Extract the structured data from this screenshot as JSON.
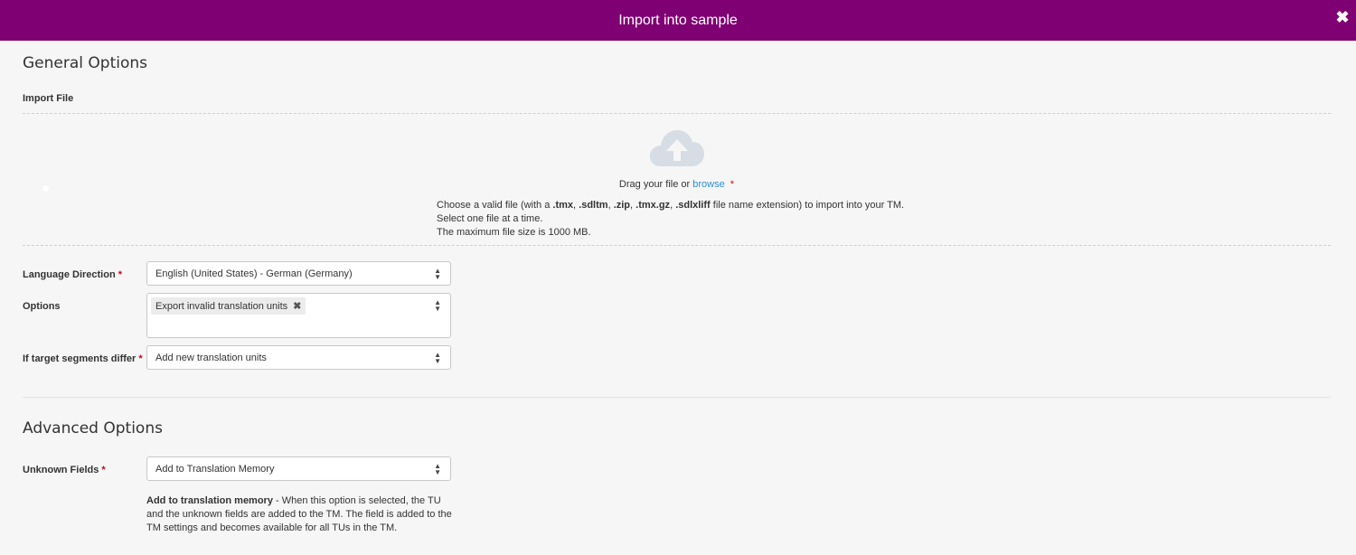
{
  "dialog": {
    "title": "Import into sample",
    "close_icon": "close-icon"
  },
  "general": {
    "title": "General Options",
    "import_file_label": "Import File",
    "upload_icon": "cloud-upload-icon",
    "drag_text": "Drag your file or",
    "browse_text": "browse",
    "required_mark": "*",
    "help": {
      "prefix": "Choose a valid file (with a",
      "ext1": ".tmx",
      "ext2": ".sdltm",
      "ext3": ".zip",
      "ext4": ".tmx.gz",
      "ext5": ".sdlxliff",
      "suffix": "file name extension) to import into your TM.",
      "line2": "Select one file at a time.",
      "line3": "The maximum file size is 1000 MB."
    },
    "language_direction": {
      "label": "Language Direction",
      "value": "English (United States) - German (Germany)"
    },
    "options": {
      "label": "Options",
      "chip": "Export invalid translation units"
    },
    "target_differ": {
      "label": "If target segments differ",
      "value": "Add new translation units"
    }
  },
  "advanced": {
    "title": "Advanced Options",
    "unknown_fields": {
      "label": "Unknown Fields",
      "value": "Add to Translation Memory"
    },
    "description": {
      "bold": "Add to translation memory",
      "text": " - When this option is selected, the TU and the unknown fields are added to the TM. The field is added to the TM settings and becomes available for all TUs in the TM."
    }
  }
}
